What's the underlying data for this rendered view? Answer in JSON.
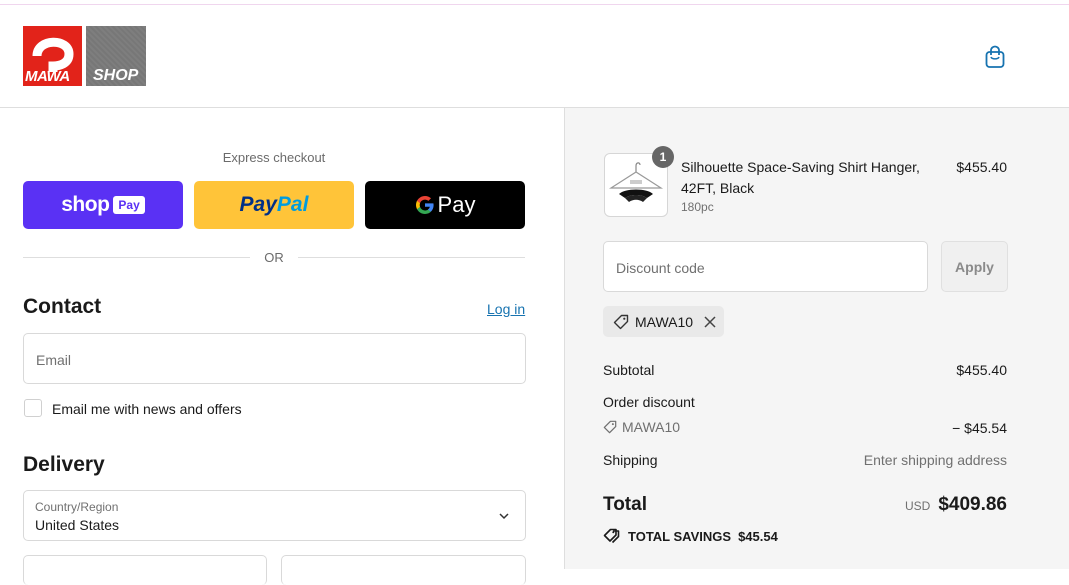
{
  "brand": {
    "logo_left": "MAWA",
    "logo_right": "SHOP"
  },
  "header": {
    "cart_icon": "shopping-bag-icon"
  },
  "express": {
    "title": "Express checkout",
    "shop_pay": {
      "word": "shop",
      "badge": "Pay"
    },
    "paypal": {
      "part1": "Pay",
      "part2": "Pal"
    },
    "gpay": {
      "word": "Pay"
    },
    "or_text": "OR"
  },
  "contact": {
    "title": "Contact",
    "login_label": "Log in",
    "email_placeholder": "Email",
    "newsletter_label": "Email me with news and offers"
  },
  "delivery": {
    "title": "Delivery",
    "country_label": "Country/Region",
    "country_value": "United States"
  },
  "order": {
    "item": {
      "name": "Silhouette Space-Saving Shirt Hanger, 42FT, Black",
      "variant": "180pc",
      "price": "$455.40",
      "quantity": "1"
    },
    "discount_placeholder": "Discount code",
    "apply_label": "Apply",
    "applied_code": "MAWA10",
    "subtotal_label": "Subtotal",
    "subtotal_value": "$455.40",
    "order_discount_label": "Order discount",
    "discount_code": "MAWA10",
    "discount_value": "− $45.54",
    "shipping_label": "Shipping",
    "shipping_value": "Enter shipping address",
    "total_label": "Total",
    "total_currency": "USD",
    "total_value": "$409.86",
    "savings_label": "TOTAL SAVINGS",
    "savings_value": "$45.54"
  },
  "colors": {
    "shop_pay": "#5a31f4",
    "paypal": "#ffc439",
    "gpay": "#000000",
    "link": "#1773b0",
    "brand_red": "#e2231a"
  }
}
